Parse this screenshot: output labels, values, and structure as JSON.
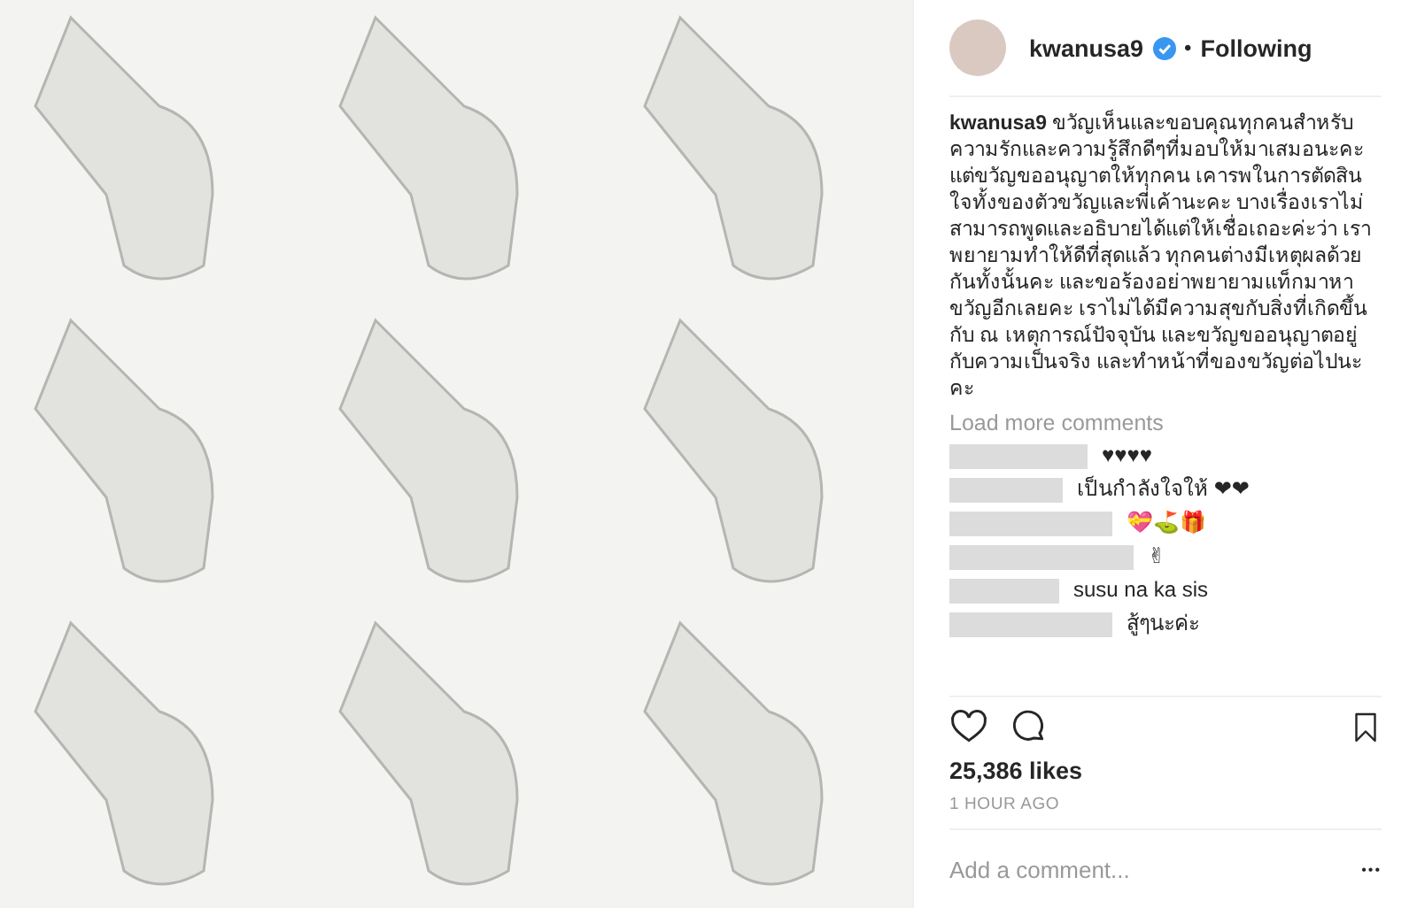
{
  "header": {
    "username": "kwanusa9",
    "verified": true,
    "separator": "•",
    "follow_status": "Following"
  },
  "caption": {
    "username": "kwanusa9",
    "text": "ขวัญเห็นและขอบคุณทุกคนสำหรับความรักและความรู้สึกดีๆที่มอบให้มาเสมอนะคะ แต่ขวัญขออนุญาตให้ทุกคน เคารพในการตัดสินใจทั้งของตัวขวัญและพี่เค้านะคะ บางเรื่องเราไม่สามารถพูดและอธิบายได้แต่ให้เชื่อเถอะค่ะว่า เราพยายามทำให้ดีที่สุดแล้ว ทุกคนต่างมีเหตุผลด้วยกันทั้งนั้นคะ และขอร้องอย่าพยายามแท็กมาหาขวัญอีกเลยคะ เราไม่ได้มีความสุขกับสิ่งที่เกิดขึ้นกับ ณ เหตุการณ์ปัจจุบัน และขวัญขออนุญาตอยู่กับความเป็นจริง และทำหน้าที่ของขวัญต่อไปนะคะ"
  },
  "load_more": "Load more comments",
  "comments": [
    {
      "text": "♥♥♥♥"
    },
    {
      "text": "เป็นกำลังใจให้ ❤❤"
    },
    {
      "text": "💝⛳🎁"
    },
    {
      "text": "✌"
    },
    {
      "text": "susu na ka sis"
    },
    {
      "text": "สู้ๆนะค่ะ"
    }
  ],
  "likes": "25,386 likes",
  "time": "1 HOUR AGO",
  "comment_field": {
    "placeholder": "Add a comment..."
  },
  "more_menu": "•••"
}
